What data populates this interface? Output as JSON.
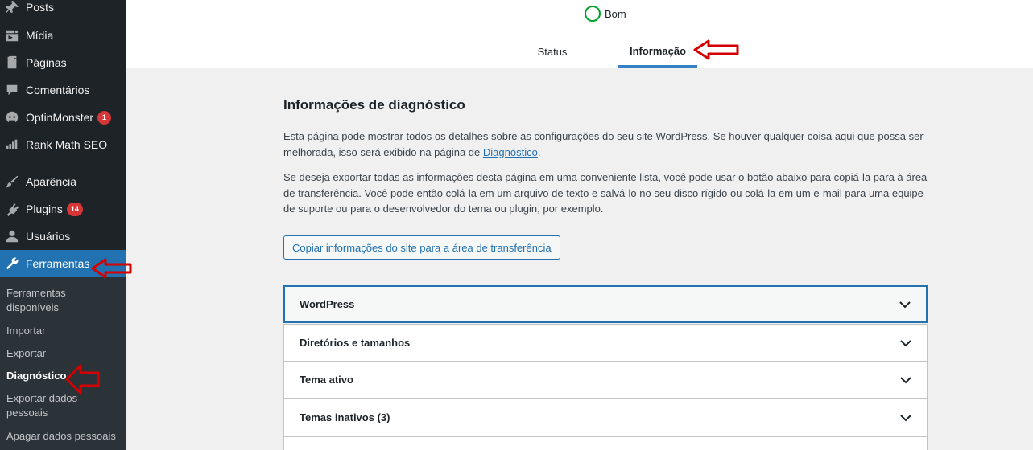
{
  "sidebar": {
    "items": [
      {
        "label": "Posts",
        "icon": "pushpin-icon"
      },
      {
        "label": "Mídia",
        "icon": "media-icon"
      },
      {
        "label": "Páginas",
        "icon": "pages-icon"
      },
      {
        "label": "Comentários",
        "icon": "comment-icon"
      },
      {
        "label": "OptinMonster",
        "icon": "optinmonster-icon",
        "badge": "1"
      },
      {
        "label": "Rank Math SEO",
        "icon": "chart-icon"
      },
      {
        "label": "Aparência",
        "icon": "paintbrush-icon"
      },
      {
        "label": "Plugins",
        "icon": "plugin-icon",
        "badge": "14"
      },
      {
        "label": "Usuários",
        "icon": "user-icon"
      },
      {
        "label": "Ferramentas",
        "icon": "wrench-icon",
        "active": true
      }
    ],
    "submenu": [
      {
        "label": "Ferramentas disponíveis"
      },
      {
        "label": "Importar"
      },
      {
        "label": "Exportar"
      },
      {
        "label": "Diagnóstico",
        "current": true
      },
      {
        "label": "Exportar dados pessoais"
      },
      {
        "label": "Apagar dados pessoais"
      }
    ]
  },
  "header": {
    "health_status": "Bom",
    "tabs": [
      {
        "label": "Status"
      },
      {
        "label": "Informação",
        "active": true
      }
    ]
  },
  "main": {
    "title": "Informações de diagnóstico",
    "para1_text": "Esta página pode mostrar todos os detalhes sobre as configurações do seu site WordPress. Se houver qualquer coisa aqui que possa ser melhorada, isso será exibido na página de ",
    "para1_link": "Diagnóstico",
    "para1_end": ".",
    "para2": "Se deseja exportar todas as informações desta página em uma conveniente lista, você pode usar o botão abaixo para copiá-la para à área de transferência. Você pode então colá-la em um arquivo de texto e salvá-lo no seu disco rígido ou colá-la em um e-mail para uma equipe de suporte ou para o desenvolvedor do tema ou plugin, por exemplo.",
    "copy_button": "Copiar informações do site para a área de transferência",
    "sections": [
      {
        "label": "WordPress"
      },
      {
        "label": "Diretórios e tamanhos"
      },
      {
        "label": "Tema ativo"
      },
      {
        "label": "Temas inativos (3)"
      },
      {
        "label": ""
      }
    ]
  },
  "colors": {
    "sidebar_bg": "#1d2327",
    "submenu_bg": "#2c3338",
    "accent": "#2271b1",
    "badge": "#d63638",
    "health_ok": "#00a32a",
    "annotation_arrow": "#d40000"
  }
}
